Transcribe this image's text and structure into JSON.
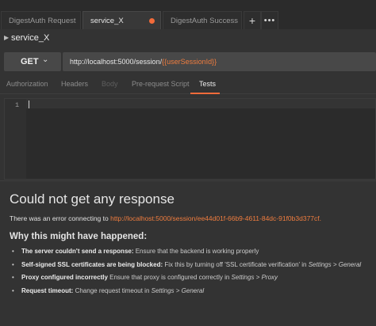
{
  "tabs": [
    {
      "label": "DigestAuth Request"
    },
    {
      "label": "service_X",
      "active": true,
      "unsaved": true
    },
    {
      "label": "DigestAuth Success"
    }
  ],
  "tab_controls": {
    "add": "+",
    "more": "•••"
  },
  "request": {
    "name": "service_X",
    "method": "GET",
    "url_prefix": "http://localhost:5000/session/",
    "url_variable": "{{userSessionId}}"
  },
  "subtabs": [
    {
      "label": "Authorization",
      "state": "normal"
    },
    {
      "label": "Headers",
      "state": "normal"
    },
    {
      "label": "Body",
      "state": "disabled"
    },
    {
      "label": "Pre-request Script",
      "state": "normal"
    },
    {
      "label": "Tests",
      "state": "active"
    }
  ],
  "editor": {
    "line_number": "1"
  },
  "response": {
    "title": "Could not get any response",
    "error_prefix": "There was an error connecting to ",
    "error_url": "http://localhost:5000/session/ee44d01f-66b9-4611-84dc-91f0b3d377cf.",
    "why_title": "Why this might have happened:",
    "reasons": [
      {
        "bold": "The server couldn't send a response:",
        "text": " Ensure that the backend is working properly"
      },
      {
        "bold": "Self-signed SSL certificates are being blocked:",
        "text": " Fix this by turning off 'SSL certificate verification' in ",
        "italic": "Settings > General"
      },
      {
        "bold": "Proxy configured incorrectly",
        "text": " Ensure that proxy is configured correctly in ",
        "italic": "Settings > Proxy"
      },
      {
        "bold": "Request timeout:",
        "text": " Change request timeout in ",
        "italic": "Settings > General"
      }
    ]
  },
  "colors": {
    "accent": "#f26b3a",
    "background": "#333333"
  }
}
